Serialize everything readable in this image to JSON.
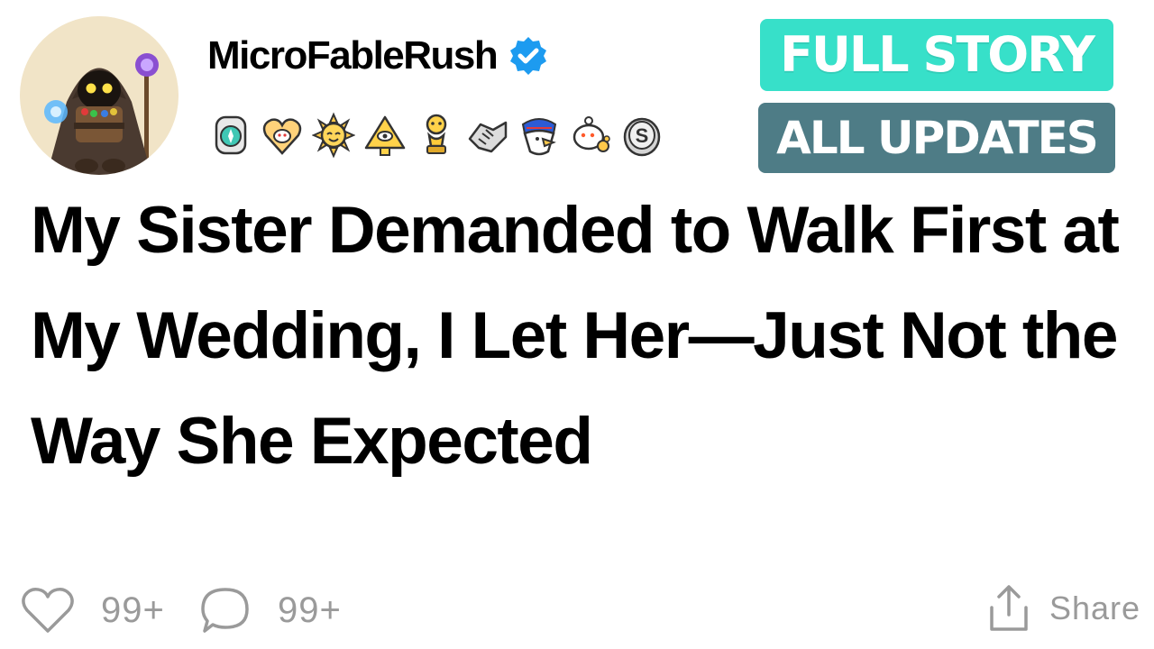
{
  "post": {
    "username": "MicroFableRush",
    "verified": true,
    "title": "My Sister Demanded to Walk First at My Wedding, I Let Her—Just Not the Way She Expected"
  },
  "badges": {
    "full_story": "FULL STORY",
    "all_updates": "ALL UPDATES",
    "full_story_color": "#37e0c9",
    "all_updates_color": "#4e7c86"
  },
  "awards": [
    {
      "icon": "compass-medal-icon"
    },
    {
      "icon": "heart-snoo-icon"
    },
    {
      "icon": "sun-face-icon"
    },
    {
      "icon": "pyramid-eye-icon"
    },
    {
      "icon": "trophy-snoo-icon"
    },
    {
      "icon": "handshake-icon"
    },
    {
      "icon": "eagle-icon"
    },
    {
      "icon": "snoo-blowing-icon"
    },
    {
      "icon": "silver-coin-icon"
    }
  ],
  "footer": {
    "likes": "99+",
    "comments": "99+",
    "share_label": "Share"
  },
  "colors": {
    "text": "#000000",
    "muted": "#9a9a9a",
    "verified": "#1d9bf0"
  }
}
